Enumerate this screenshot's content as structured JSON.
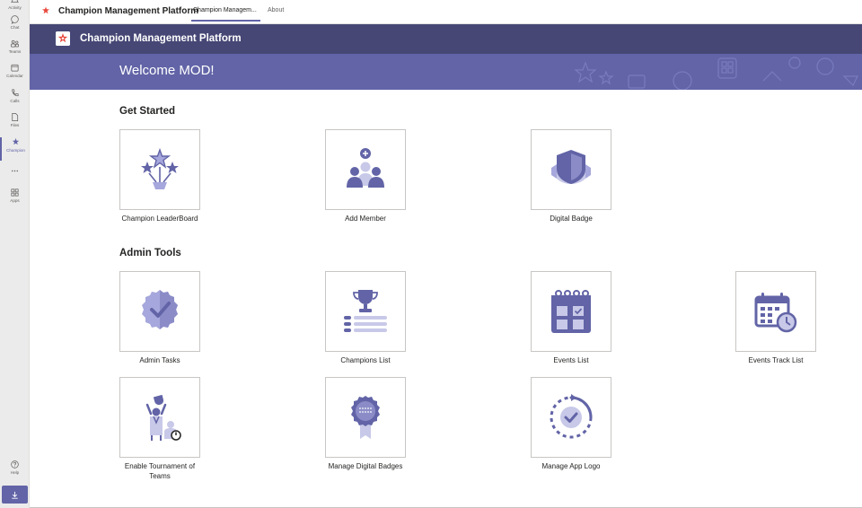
{
  "rail": {
    "items": [
      {
        "label": "Activity",
        "icon": "bell-icon"
      },
      {
        "label": "Chat",
        "icon": "chat-icon"
      },
      {
        "label": "Teams",
        "icon": "teams-icon"
      },
      {
        "label": "Calendar",
        "icon": "calendar-icon"
      },
      {
        "label": "Calls",
        "icon": "phone-icon"
      },
      {
        "label": "Files",
        "icon": "file-icon"
      },
      {
        "label": "Champion",
        "icon": "champion-icon",
        "active": true
      },
      {
        "label": "",
        "icon": "more-icon"
      },
      {
        "label": "Apps",
        "icon": "apps-icon"
      },
      {
        "label": "Help",
        "icon": "help-icon"
      }
    ],
    "download_icon": "download-icon"
  },
  "topbar": {
    "app_title": "Champion Management Platform",
    "tabs": [
      {
        "label": "Champion Managem...",
        "active": true
      },
      {
        "label": "About",
        "active": false
      }
    ]
  },
  "header": {
    "title": "Champion Management Platform"
  },
  "banner": {
    "welcome": "Welcome MOD!"
  },
  "sections": {
    "get_started": {
      "title": "Get Started",
      "tiles": [
        {
          "label": "Champion LeaderBoard",
          "icon": "stars-trophy-icon"
        },
        {
          "label": "Add Member",
          "icon": "add-member-icon"
        },
        {
          "label": "Digital Badge",
          "icon": "digital-badge-icon"
        }
      ]
    },
    "admin_tools": {
      "title": "Admin Tools",
      "tiles": [
        {
          "label": "Admin Tasks",
          "icon": "admin-tasks-icon"
        },
        {
          "label": "Champions List",
          "icon": "champions-list-icon"
        },
        {
          "label": "Events List",
          "icon": "events-list-icon"
        },
        {
          "label": "Events Track List",
          "icon": "events-track-icon"
        },
        {
          "label": "Enable Tournament of Teams",
          "icon": "tournament-icon"
        },
        {
          "label": "Manage Digital Badges",
          "icon": "manage-badges-icon"
        },
        {
          "label": "Manage App Logo",
          "icon": "manage-logo-icon"
        }
      ]
    }
  },
  "colors": {
    "accent": "#6264a7",
    "header_dark": "#464775",
    "icon_dark": "#6264a7",
    "icon_light": "#a6a7dc",
    "logo_red": "#e8473c"
  }
}
